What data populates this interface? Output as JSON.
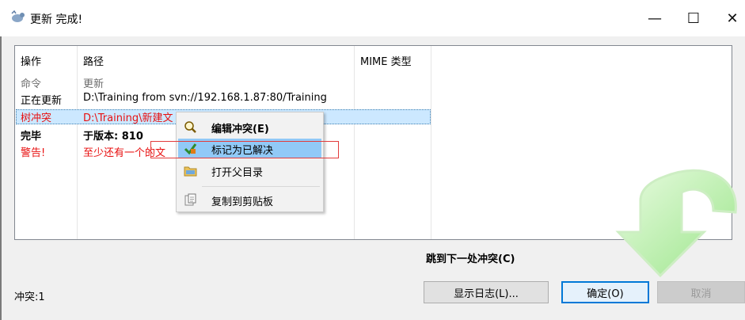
{
  "window": {
    "title": "更新 完成!",
    "icon": "tortoise-icon",
    "controls": {
      "minimize": "—",
      "maximize": "☐",
      "close": "✕"
    }
  },
  "list": {
    "headers": {
      "action": "操作",
      "path": "路径",
      "mime": "MIME 类型"
    },
    "rows": [
      {
        "action": "命令",
        "path": "更新",
        "style": "gray"
      },
      {
        "action": "正在更新",
        "path": "D:\\Training from svn://192.168.1.87:80/Training",
        "style": "normal"
      },
      {
        "action": "树冲突",
        "path": "D:\\Training\\新建文",
        "style": "red-selected"
      },
      {
        "action": "完毕",
        "path": "于版本: 810",
        "style": "bold"
      },
      {
        "action": "警告!",
        "path": "至少还有一个的文",
        "style": "red"
      }
    ]
  },
  "context_menu": {
    "items": [
      {
        "label": "编辑冲突(E)",
        "icon": "magnifier-icon",
        "bold": true
      },
      {
        "label": "标记为已解决",
        "icon": "resolved-check-icon",
        "highlighted": true
      },
      {
        "label": "打开父目录",
        "icon": "folder-icon"
      },
      {
        "label": "复制到剪贴板",
        "icon": "clipboard-icon"
      }
    ]
  },
  "footer": {
    "jump_label": "跳到下一处冲突(C)",
    "status": "冲突:1",
    "show_log": "显示日志(L)...",
    "ok": "确定(O)",
    "cancel": "取消"
  },
  "colors": {
    "accent": "#0078d7",
    "conflict_red": "#e81010",
    "arrow_green": "#9be58a",
    "highlight": "#91c9f7"
  }
}
